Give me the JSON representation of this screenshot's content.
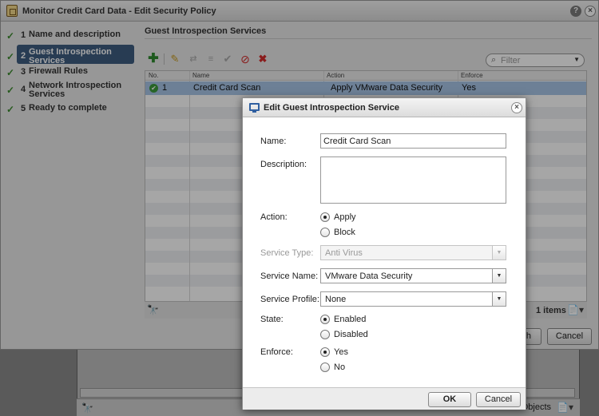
{
  "wizard": {
    "title": "Monitor Credit Card Data - Edit Security Policy",
    "help_glyph": "?",
    "close_glyph": "×",
    "steps": [
      {
        "num": "1",
        "label": "Name and description",
        "check": "✓"
      },
      {
        "num": "2",
        "label": "Guest Introspection Services",
        "check": "✓"
      },
      {
        "num": "3",
        "label": "Firewall Rules",
        "check": "✓"
      },
      {
        "num": "4",
        "label": "Network Introspection Services",
        "check": "✓"
      },
      {
        "num": "5",
        "label": "Ready to complete",
        "check": "✓"
      }
    ],
    "active_step": 2,
    "section_title": "Guest Introspection Services",
    "filter_placeholder": "Filter",
    "table": {
      "columns": [
        "No.",
        "Name",
        "Action",
        "Enforce"
      ],
      "rows": [
        {
          "no": "1",
          "name": "Credit Card Scan",
          "action": "Apply VMware Data Security",
          "enforce": "Yes"
        }
      ]
    },
    "items_count": "1 items",
    "finish_label": "Finish",
    "finish_visible": "h",
    "cancel_label": "Cancel"
  },
  "background": {
    "objects_label": "Objects"
  },
  "dialog": {
    "title": "Edit Guest Introspection Service",
    "close_glyph": "×",
    "name_label": "Name:",
    "name_value": "Credit Card Scan",
    "description_label": "Description:",
    "description_value": "",
    "action_label": "Action:",
    "action_options": [
      "Apply",
      "Block"
    ],
    "action_selected": "Apply",
    "service_type_label": "Service Type:",
    "service_type_value": "Anti Virus",
    "service_name_label": "Service Name:",
    "service_name_value": "VMware Data Security",
    "service_profile_label": "Service Profile:",
    "service_profile_value": "None",
    "state_label": "State:",
    "state_options": [
      "Enabled",
      "Disabled"
    ],
    "state_selected": "Enabled",
    "enforce_label": "Enforce:",
    "enforce_options": [
      "Yes",
      "No"
    ],
    "enforce_selected": "Yes",
    "ok_label": "OK",
    "cancel_label": "Cancel"
  },
  "colors": {
    "nav_active": "#3e5c80",
    "selected_row": "#a8c5e6",
    "check_green": "#3d8a2e",
    "delete_red": "#d32b2b"
  },
  "icons": {
    "wizard_title": "policy-icon",
    "help": "help-icon",
    "close": "close-icon",
    "add": "add-icon",
    "edit": "pencil-icon",
    "move_up": "move-up-icon",
    "move_down": "move-down-icon",
    "enable": "check-icon",
    "disable": "disable-icon",
    "delete": "delete-icon",
    "search": "search-icon",
    "find": "binoculars-icon",
    "export": "export-icon",
    "status_ok": "status-ok-icon",
    "dialog_title": "vm-icon"
  }
}
